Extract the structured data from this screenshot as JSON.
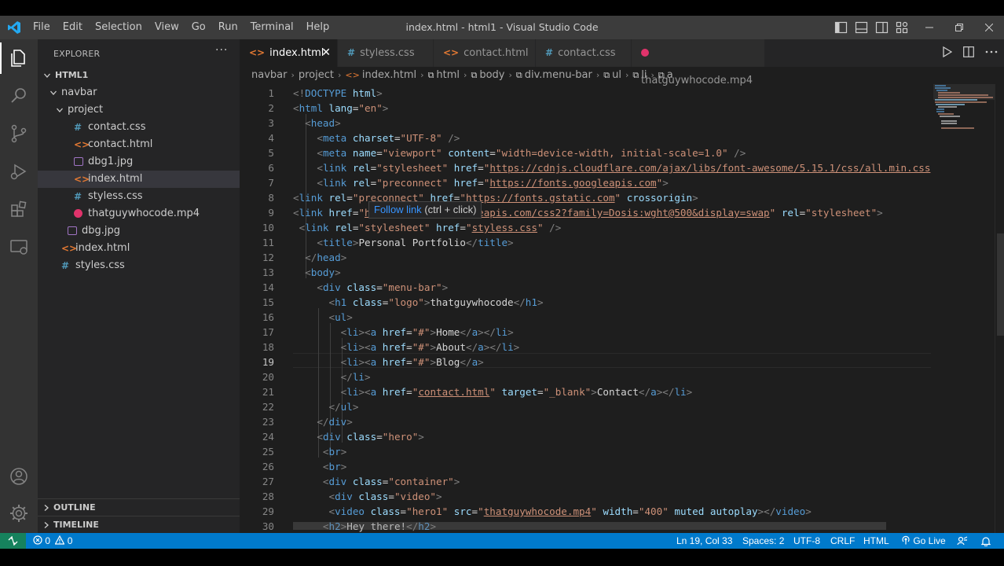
{
  "window": {
    "title": "index.html - html1 - Visual Studio Code",
    "menu": [
      "File",
      "Edit",
      "Selection",
      "View",
      "Go",
      "Run",
      "Terminal",
      "Help"
    ]
  },
  "sidebar": {
    "title": "EXPLORER",
    "more": "···",
    "tree": [
      {
        "label": "HTML1",
        "type": "root"
      },
      {
        "label": "navbar",
        "type": "folder"
      },
      {
        "label": "project",
        "type": "folder"
      },
      {
        "label": "contact.css",
        "type": "css",
        "icon": "#"
      },
      {
        "label": "contact.html",
        "type": "html",
        "icon": "<>"
      },
      {
        "label": "dbg1.jpg",
        "type": "image"
      },
      {
        "label": "index.html",
        "type": "html",
        "icon": "<>",
        "selected": true
      },
      {
        "label": "styless.css",
        "type": "css",
        "icon": "#"
      },
      {
        "label": "thatguywhocode.mp4",
        "type": "video"
      },
      {
        "label": "dbg.jpg",
        "type": "image"
      },
      {
        "label": "index.html",
        "type": "html",
        "icon": "<>"
      },
      {
        "label": "styles.css",
        "type": "css",
        "icon": "#"
      }
    ],
    "outline": "OUTLINE",
    "timeline": "TIMELINE"
  },
  "tabs": [
    {
      "label": "index.html",
      "icon": "<>",
      "active": true
    },
    {
      "label": "styless.css",
      "icon": "#"
    },
    {
      "label": "contact.html",
      "icon": "<>"
    },
    {
      "label": "contact.css",
      "icon": "#"
    },
    {
      "label": "thatguywhocode.mp4",
      "icon": "video"
    }
  ],
  "breadcrumb": [
    "navbar",
    "project",
    "index.html",
    "html",
    "body",
    "div.menu-bar",
    "ul",
    "li",
    "a"
  ],
  "editor": {
    "current_line": 19,
    "tooltip": {
      "link": "Follow link",
      "hint": "(ctrl + click)"
    },
    "lines": [
      [
        [
          "br",
          "<!"
        ],
        [
          "tag",
          "DOCTYPE"
        ],
        [
          "attr",
          " html"
        ],
        [
          "br",
          ">"
        ]
      ],
      [
        [
          "br",
          "<"
        ],
        [
          "tag",
          "html"
        ],
        [
          "attr",
          " lang"
        ],
        [
          "txt",
          "="
        ],
        [
          "str",
          "\"en\""
        ],
        [
          "br",
          ">"
        ]
      ],
      [
        [
          "txt",
          "  "
        ],
        [
          "br",
          "<"
        ],
        [
          "tag",
          "head"
        ],
        [
          "br",
          ">"
        ]
      ],
      [
        [
          "txt",
          "    "
        ],
        [
          "br",
          "<"
        ],
        [
          "tag",
          "meta"
        ],
        [
          "attr",
          " charset"
        ],
        [
          "txt",
          "="
        ],
        [
          "str",
          "\"UTF-8\""
        ],
        [
          "br",
          " />"
        ]
      ],
      [
        [
          "txt",
          "    "
        ],
        [
          "br",
          "<"
        ],
        [
          "tag",
          "meta"
        ],
        [
          "attr",
          " name"
        ],
        [
          "txt",
          "="
        ],
        [
          "str",
          "\"viewport\""
        ],
        [
          "attr",
          " content"
        ],
        [
          "txt",
          "="
        ],
        [
          "str",
          "\"width=device-width, initial-scale=1.0\""
        ],
        [
          "br",
          " />"
        ]
      ],
      [
        [
          "txt",
          "    "
        ],
        [
          "br",
          "<"
        ],
        [
          "tag",
          "link"
        ],
        [
          "attr",
          " rel"
        ],
        [
          "txt",
          "="
        ],
        [
          "str",
          "\"stylesheet\""
        ],
        [
          "attr",
          " href"
        ],
        [
          "txt",
          "="
        ],
        [
          "str",
          "\""
        ],
        [
          "link",
          "https://cdnjs.cloudflare.com/ajax/libs/font-awesome/5.15.1/css/all.min.css"
        ]
      ],
      [
        [
          "txt",
          "    "
        ],
        [
          "br",
          "<"
        ],
        [
          "tag",
          "link"
        ],
        [
          "attr",
          " rel"
        ],
        [
          "txt",
          "="
        ],
        [
          "str",
          "\"preconnect\""
        ],
        [
          "attr",
          " href"
        ],
        [
          "txt",
          "="
        ],
        [
          "str",
          "\""
        ],
        [
          "link",
          "https://fonts.googleapis.com"
        ],
        [
          "str",
          "\""
        ],
        [
          "br",
          ">"
        ]
      ],
      [
        [
          "br",
          "<"
        ],
        [
          "tag",
          "link"
        ],
        [
          "attr",
          " rel"
        ],
        [
          "txt",
          "="
        ],
        [
          "str",
          "\"preconnect\""
        ],
        [
          "attr",
          " href"
        ],
        [
          "txt",
          "="
        ],
        [
          "str",
          "\""
        ],
        [
          "link",
          "https://fonts.gstatic.com"
        ],
        [
          "str",
          "\""
        ],
        [
          "attr",
          " crossorigin"
        ],
        [
          "br",
          ">"
        ]
      ],
      [
        [
          "br",
          "<"
        ],
        [
          "tag",
          "link"
        ],
        [
          "attr",
          " href"
        ],
        [
          "txt",
          "="
        ],
        [
          "str",
          "\""
        ],
        [
          "link",
          "https://fonts.googleapis.com/css2?family=Dosis:wght@500&display=swap"
        ],
        [
          "str",
          "\""
        ],
        [
          "attr",
          " rel"
        ],
        [
          "txt",
          "="
        ],
        [
          "str",
          "\"stylesheet\""
        ],
        [
          "br",
          ">"
        ]
      ],
      [
        [
          "txt",
          " "
        ],
        [
          "br",
          "<"
        ],
        [
          "tag",
          "link"
        ],
        [
          "attr",
          " rel"
        ],
        [
          "txt",
          "="
        ],
        [
          "str",
          "\"stylesheet\""
        ],
        [
          "attr",
          " href"
        ],
        [
          "txt",
          "="
        ],
        [
          "str",
          "\""
        ],
        [
          "link",
          "styless.css"
        ],
        [
          "str",
          "\""
        ],
        [
          "br",
          " />"
        ]
      ],
      [
        [
          "txt",
          "    "
        ],
        [
          "br",
          "<"
        ],
        [
          "tag",
          "title"
        ],
        [
          "br",
          ">"
        ],
        [
          "txt",
          "Personal Portfolio"
        ],
        [
          "br",
          "</"
        ],
        [
          "tag",
          "title"
        ],
        [
          "br",
          ">"
        ]
      ],
      [
        [
          "txt",
          "  "
        ],
        [
          "br",
          "</"
        ],
        [
          "tag",
          "head"
        ],
        [
          "br",
          ">"
        ]
      ],
      [
        [
          "txt",
          "  "
        ],
        [
          "br",
          "<"
        ],
        [
          "tag",
          "body"
        ],
        [
          "br",
          ">"
        ]
      ],
      [
        [
          "txt",
          "    "
        ],
        [
          "br",
          "<"
        ],
        [
          "tag",
          "div"
        ],
        [
          "attr",
          " class"
        ],
        [
          "txt",
          "="
        ],
        [
          "str",
          "\"menu-bar\""
        ],
        [
          "br",
          ">"
        ]
      ],
      [
        [
          "txt",
          "      "
        ],
        [
          "br",
          "<"
        ],
        [
          "tag",
          "h1"
        ],
        [
          "attr",
          " class"
        ],
        [
          "txt",
          "="
        ],
        [
          "str",
          "\"logo\""
        ],
        [
          "br",
          ">"
        ],
        [
          "txt",
          "thatguywhocode"
        ],
        [
          "br",
          "</"
        ],
        [
          "tag",
          "h1"
        ],
        [
          "br",
          ">"
        ]
      ],
      [
        [
          "txt",
          "      "
        ],
        [
          "br",
          "<"
        ],
        [
          "tag",
          "ul"
        ],
        [
          "br",
          ">"
        ]
      ],
      [
        [
          "txt",
          "        "
        ],
        [
          "br",
          "<"
        ],
        [
          "tag",
          "li"
        ],
        [
          "br",
          "><"
        ],
        [
          "tag",
          "a"
        ],
        [
          "attr",
          " href"
        ],
        [
          "txt",
          "="
        ],
        [
          "str",
          "\"#\""
        ],
        [
          "br",
          ">"
        ],
        [
          "txt",
          "Home"
        ],
        [
          "br",
          "</"
        ],
        [
          "tag",
          "a"
        ],
        [
          "br",
          "></"
        ],
        [
          "tag",
          "li"
        ],
        [
          "br",
          ">"
        ]
      ],
      [
        [
          "txt",
          "        "
        ],
        [
          "br",
          "<"
        ],
        [
          "tag",
          "li"
        ],
        [
          "br",
          "><"
        ],
        [
          "tag",
          "a"
        ],
        [
          "attr",
          " href"
        ],
        [
          "txt",
          "="
        ],
        [
          "str",
          "\"#\""
        ],
        [
          "br",
          ">"
        ],
        [
          "txt",
          "About"
        ],
        [
          "br",
          "</"
        ],
        [
          "tag",
          "a"
        ],
        [
          "br",
          "></"
        ],
        [
          "tag",
          "li"
        ],
        [
          "br",
          ">"
        ]
      ],
      [
        [
          "txt",
          "        "
        ],
        [
          "br",
          "<"
        ],
        [
          "tag",
          "li"
        ],
        [
          "br",
          "><"
        ],
        [
          "tag",
          "a"
        ],
        [
          "attr",
          " href"
        ],
        [
          "txt",
          "="
        ],
        [
          "str",
          "\"#\""
        ],
        [
          "br",
          ">"
        ],
        [
          "txt",
          "Blog"
        ],
        [
          "br",
          "</"
        ],
        [
          "tag",
          "a"
        ],
        [
          "br",
          ">"
        ]
      ],
      [
        [
          "txt",
          "        "
        ],
        [
          "br",
          "</"
        ],
        [
          "tag",
          "li"
        ],
        [
          "br",
          ">"
        ]
      ],
      [
        [
          "txt",
          "        "
        ],
        [
          "br",
          "<"
        ],
        [
          "tag",
          "li"
        ],
        [
          "br",
          "><"
        ],
        [
          "tag",
          "a"
        ],
        [
          "attr",
          " href"
        ],
        [
          "txt",
          "="
        ],
        [
          "str",
          "\""
        ],
        [
          "link",
          "contact.html"
        ],
        [
          "str",
          "\""
        ],
        [
          "attr",
          " target"
        ],
        [
          "txt",
          "="
        ],
        [
          "str",
          "\"_blank\""
        ],
        [
          "br",
          ">"
        ],
        [
          "txt",
          "Contact"
        ],
        [
          "br",
          "</"
        ],
        [
          "tag",
          "a"
        ],
        [
          "br",
          "></"
        ],
        [
          "tag",
          "li"
        ],
        [
          "br",
          ">"
        ]
      ],
      [
        [
          "txt",
          "      "
        ],
        [
          "br",
          "</"
        ],
        [
          "tag",
          "ul"
        ],
        [
          "br",
          ">"
        ]
      ],
      [
        [
          "txt",
          "    "
        ],
        [
          "br",
          "</"
        ],
        [
          "tag",
          "div"
        ],
        [
          "br",
          ">"
        ]
      ],
      [
        [
          "txt",
          "    "
        ],
        [
          "br",
          "<"
        ],
        [
          "tag",
          "div"
        ],
        [
          "attr",
          " class"
        ],
        [
          "txt",
          "="
        ],
        [
          "str",
          "\"hero\""
        ],
        [
          "br",
          ">"
        ]
      ],
      [
        [
          "txt",
          "     "
        ],
        [
          "br",
          "<"
        ],
        [
          "tag",
          "br"
        ],
        [
          "br",
          ">"
        ]
      ],
      [
        [
          "txt",
          "     "
        ],
        [
          "br",
          "<"
        ],
        [
          "tag",
          "br"
        ],
        [
          "br",
          ">"
        ]
      ],
      [
        [
          "txt",
          "     "
        ],
        [
          "br",
          "<"
        ],
        [
          "tag",
          "div"
        ],
        [
          "attr",
          " class"
        ],
        [
          "txt",
          "="
        ],
        [
          "str",
          "\"container\""
        ],
        [
          "br",
          ">"
        ]
      ],
      [
        [
          "txt",
          "      "
        ],
        [
          "br",
          "<"
        ],
        [
          "tag",
          "div"
        ],
        [
          "attr",
          " class"
        ],
        [
          "txt",
          "="
        ],
        [
          "str",
          "\"video\""
        ],
        [
          "br",
          ">"
        ]
      ],
      [
        [
          "txt",
          "      "
        ],
        [
          "br",
          "<"
        ],
        [
          "tag",
          "video"
        ],
        [
          "attr",
          " class"
        ],
        [
          "txt",
          "="
        ],
        [
          "str",
          "\"hero1\""
        ],
        [
          "attr",
          " src"
        ],
        [
          "txt",
          "="
        ],
        [
          "str",
          "\""
        ],
        [
          "link",
          "thatguywhocode.mp4"
        ],
        [
          "str",
          "\""
        ],
        [
          "attr",
          " width"
        ],
        [
          "txt",
          "="
        ],
        [
          "str",
          "\"400\""
        ],
        [
          "attr",
          " muted autoplay"
        ],
        [
          "br",
          "></"
        ],
        [
          "tag",
          "video"
        ],
        [
          "br",
          ">"
        ]
      ],
      [
        [
          "txt",
          "     "
        ],
        [
          "br",
          "<"
        ],
        [
          "tag",
          "h2"
        ],
        [
          "br",
          ">"
        ],
        [
          "txt",
          "Hey there!"
        ],
        [
          "br",
          "</"
        ],
        [
          "tag",
          "h2"
        ],
        [
          "br",
          ">"
        ]
      ]
    ]
  },
  "statusbar": {
    "errors": "0",
    "warnings": "0",
    "position": "Ln 19, Col 33",
    "spaces": "Spaces: 2",
    "encoding": "UTF-8",
    "eol": "CRLF",
    "language": "HTML",
    "golive": "Go Live"
  },
  "colors": {
    "statusbar": "#007acc",
    "activitybar": "#333333",
    "sidebar": "#252526",
    "editor": "#1e1e1e",
    "tag": "#569cd6",
    "attribute": "#9cdcfe",
    "string": "#ce9178"
  }
}
